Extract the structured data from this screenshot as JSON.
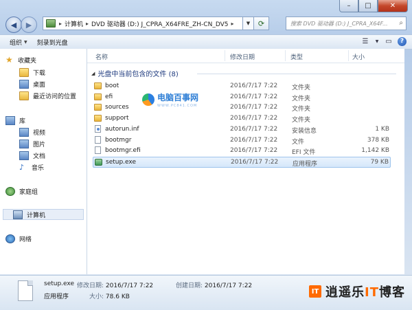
{
  "window": {
    "caption": {
      "minimize": "–",
      "maximize": "□",
      "close": "✕"
    }
  },
  "address": {
    "segments": [
      "计算机",
      "DVD 驱动器 (D:) J_CPRA_X64FRE_ZH-CN_DV5"
    ]
  },
  "search": {
    "placeholder": "搜索 DVD 驱动器 (D:) J_CPRA_X64F..."
  },
  "toolbar": {
    "organize": "组织",
    "burn": "刻录到光盘"
  },
  "navpane": {
    "favorites": "收藏夹",
    "downloads": "下载",
    "desktop": "桌面",
    "recent": "最近访问的位置",
    "libraries": "库",
    "videos": "视频",
    "pictures": "图片",
    "documents": "文档",
    "music": "音乐",
    "homegroup": "家庭组",
    "computer": "计算机",
    "network": "网络"
  },
  "columns": {
    "name": "名称",
    "date": "修改日期",
    "type": "类型",
    "size": "大小"
  },
  "group": {
    "label": "光盘中当前包含的文件 (8)"
  },
  "files": [
    {
      "name": "boot",
      "date": "2016/7/17 7:22",
      "type": "文件夹",
      "size": "",
      "icon": "folder"
    },
    {
      "name": "efi",
      "date": "2016/7/17 7:22",
      "type": "文件夹",
      "size": "",
      "icon": "folder"
    },
    {
      "name": "sources",
      "date": "2016/7/17 7:22",
      "type": "文件夹",
      "size": "",
      "icon": "folder"
    },
    {
      "name": "support",
      "date": "2016/7/17 7:22",
      "type": "文件夹",
      "size": "",
      "icon": "folder"
    },
    {
      "name": "autorun.inf",
      "date": "2016/7/17 7:22",
      "type": "安装信息",
      "size": "1 KB",
      "icon": "inf"
    },
    {
      "name": "bootmgr",
      "date": "2016/7/17 7:22",
      "type": "文件",
      "size": "378 KB",
      "icon": "file"
    },
    {
      "name": "bootmgr.efi",
      "date": "2016/7/17 7:22",
      "type": "EFI 文件",
      "size": "1,142 KB",
      "icon": "file"
    },
    {
      "name": "setup.exe",
      "date": "2016/7/17 7:22",
      "type": "应用程序",
      "size": "79 KB",
      "icon": "exe"
    }
  ],
  "watermark": {
    "title": "电脑百事网",
    "url": "WWW.PC841.COM"
  },
  "details": {
    "name": "setup.exe",
    "modified_label": "修改日期:",
    "modified": "2016/7/17 7:22",
    "created_label": "创建日期:",
    "created": "2016/7/17 7:22",
    "type": "应用程序",
    "size_label": "大小:",
    "size": "78.6 KB"
  },
  "brand": {
    "badge": "IT",
    "text_a": "逍遥乐",
    "text_hl": "IT",
    "text_b": "博客"
  }
}
